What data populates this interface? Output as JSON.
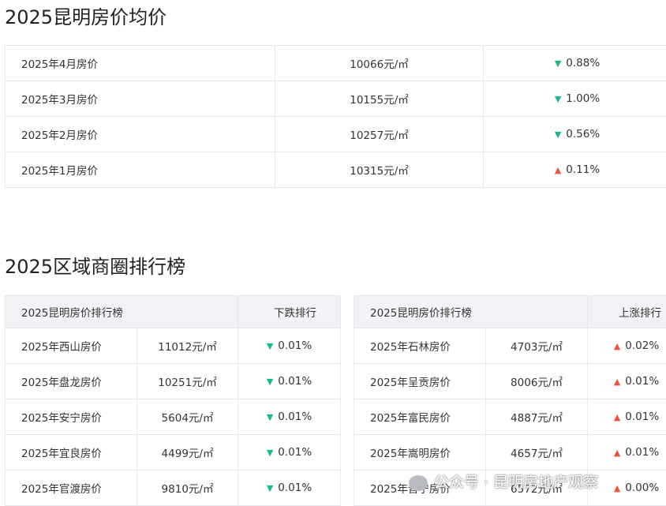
{
  "sections": {
    "monthly_title": "2025昆明房价均价",
    "ranking_title": "2025区域商圈排行榜"
  },
  "monthly": [
    {
      "label": "2025年4月房价",
      "price": "10066元/㎡",
      "direction": "down",
      "change": "0.88%"
    },
    {
      "label": "2025年3月房价",
      "price": "10155元/㎡",
      "direction": "down",
      "change": "1.00%"
    },
    {
      "label": "2025年2月房价",
      "price": "10257元/㎡",
      "direction": "down",
      "change": "0.56%"
    },
    {
      "label": "2025年1月房价",
      "price": "10315元/㎡",
      "direction": "up",
      "change": "0.11%"
    }
  ],
  "ranking_left": {
    "header_title": "2025昆明房价排行榜",
    "header_type": "下跌排行",
    "rows": [
      {
        "name": "2025年西山房价",
        "price": "11012元/㎡",
        "direction": "down",
        "change": "0.01%"
      },
      {
        "name": "2025年盘龙房价",
        "price": "10251元/㎡",
        "direction": "down",
        "change": "0.01%"
      },
      {
        "name": "2025年安宁房价",
        "price": "5604元/㎡",
        "direction": "down",
        "change": "0.01%"
      },
      {
        "name": "2025年宜良房价",
        "price": "4499元/㎡",
        "direction": "down",
        "change": "0.01%"
      },
      {
        "name": "2025年官渡房价",
        "price": "9810元/㎡",
        "direction": "down",
        "change": "0.01%"
      }
    ]
  },
  "ranking_right": {
    "header_title": "2025昆明房价排行榜",
    "header_type": "上涨排行",
    "rows": [
      {
        "name": "2025年石林房价",
        "price": "4703元/㎡",
        "direction": "up",
        "change": "0.02%"
      },
      {
        "name": "2025年呈贡房价",
        "price": "8006元/㎡",
        "direction": "up",
        "change": "0.01%"
      },
      {
        "name": "2025年富民房价",
        "price": "4887元/㎡",
        "direction": "up",
        "change": "0.01%"
      },
      {
        "name": "2025年嵩明房价",
        "price": "4657元/㎡",
        "direction": "up",
        "change": "0.01%"
      },
      {
        "name": "2025年晋宁房价",
        "price": "6572元/㎡",
        "direction": "up",
        "change": "0.00%"
      }
    ]
  },
  "icons": {
    "down": "triangle-down-icon",
    "up": "triangle-up-icon"
  },
  "colors": {
    "down": "#1bb893",
    "up": "#f0533f"
  },
  "watermark": {
    "text": "公众号 · 昆明房地产观察"
  }
}
